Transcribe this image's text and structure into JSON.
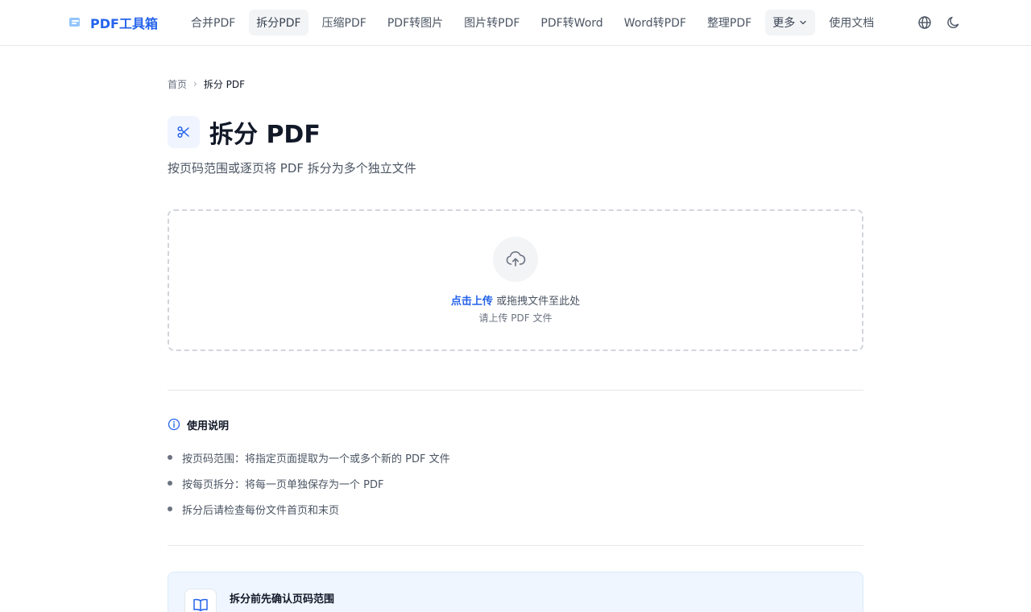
{
  "header": {
    "logo_text": "PDF工具箱",
    "nav": [
      {
        "label": "合并PDF"
      },
      {
        "label": "拆分PDF"
      },
      {
        "label": "压缩PDF"
      },
      {
        "label": "PDF转图片"
      },
      {
        "label": "图片转PDF"
      },
      {
        "label": "PDF转Word"
      },
      {
        "label": "Word转PDF"
      },
      {
        "label": "整理PDF"
      },
      {
        "label": "更多"
      },
      {
        "label": "使用文档"
      }
    ],
    "active_nav": "拆分PDF",
    "icons": [
      "globe-icon",
      "moon-icon"
    ]
  },
  "breadcrumb": {
    "home": "首页",
    "separator": "›",
    "current": "拆分 PDF"
  },
  "page": {
    "title": "拆分 PDF",
    "subtitle": "按页码范围或逐页将 PDF 拆分为多个独立文件",
    "title_icon": "scissors-icon"
  },
  "dropzone": {
    "link_text": "点击上传",
    "text": " 或拖拽文件至此处",
    "hint": "请上传 PDF 文件",
    "icon": "upload-cloud-icon"
  },
  "usage": {
    "title": "使用说明",
    "items": [
      "按页码范围：将指定页面提取为一个或多个新的 PDF 文件",
      "按每页拆分：将每一页单独保存为一个 PDF",
      "拆分后请检查每份文件首页和末页"
    ]
  },
  "tip": {
    "title": "拆分前先确认页码范围",
    "icon": "book-icon"
  },
  "colors": {
    "accent": "#2563eb",
    "text": "#111827",
    "muted": "#4b5563",
    "border": "#e5e7eb",
    "tip_bg": "#eff6ff"
  }
}
